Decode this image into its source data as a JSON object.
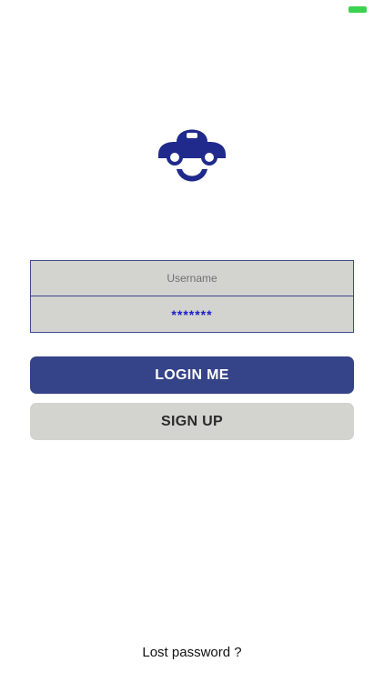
{
  "colors": {
    "brand": "#1f2a8c",
    "field_background": "#d3d3d0",
    "field_border": "#3a4a8c",
    "login_button_bg": "#354389",
    "login_button_text": "#ffffff",
    "signup_button_bg": "#d3d3d0",
    "signup_button_text": "#2b2b2b",
    "password_text": "#1c1cc8",
    "battery": "#3ad24e"
  },
  "status_bar": {
    "battery_icon": "battery-icon"
  },
  "logo": {
    "icon": "car-face-logo"
  },
  "form": {
    "username": {
      "placeholder": "Username",
      "value": ""
    },
    "password": {
      "value": "*******"
    }
  },
  "buttons": {
    "login_label": "LOGIN ME",
    "signup_label": "SIGN UP"
  },
  "footer": {
    "lost_password_label": "Lost password ?"
  }
}
